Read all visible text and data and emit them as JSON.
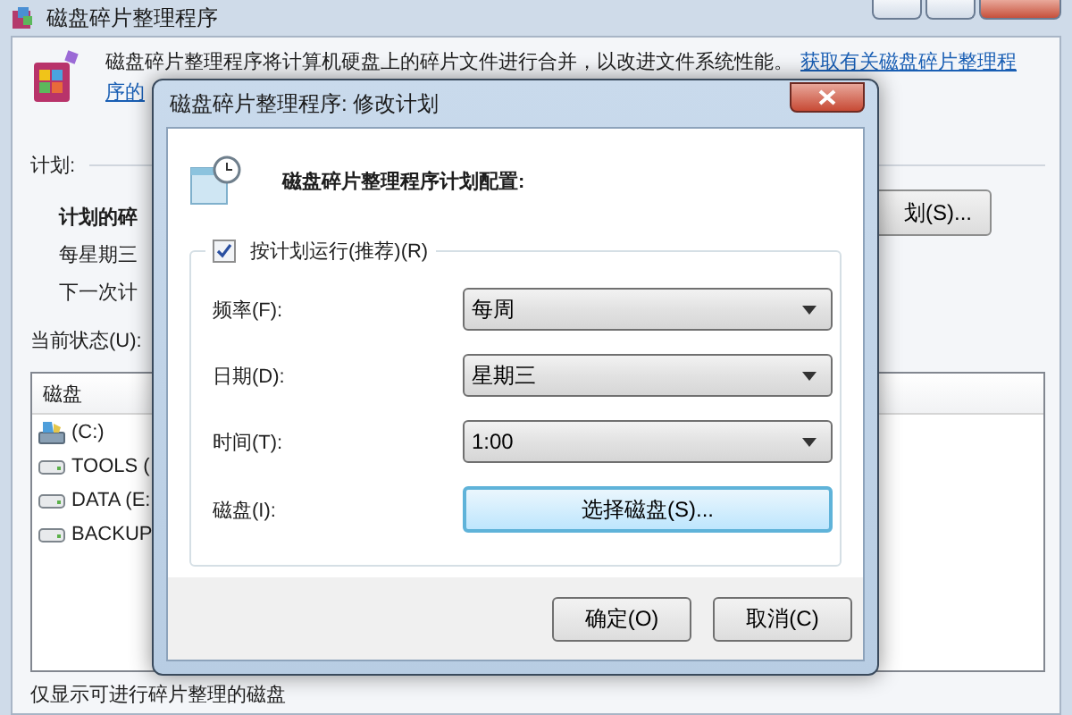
{
  "window": {
    "title": "磁盘碎片整理程序",
    "description": "磁盘碎片整理程序将计算机硬盘上的碎片文件进行合并，以改进文件系统性能。",
    "help_link_lines": [
      "获取有关磁盘碎片整理程",
      "序的"
    ]
  },
  "schedule": {
    "heading": "计划:",
    "title": "计划的碎",
    "frequency": "每星期三",
    "next_run": "下一次计",
    "configure_button": "划(S)..."
  },
  "status": {
    "label": "当前状态(U):",
    "column": "磁盘",
    "disks": [
      {
        "name": "(C:)",
        "kind": "system"
      },
      {
        "name": "TOOLS (",
        "kind": "drive"
      },
      {
        "name": "DATA (E:",
        "kind": "drive"
      },
      {
        "name": "BACKUP",
        "kind": "drive"
      }
    ]
  },
  "footer_note": "仅显示可进行碎片整理的磁盘",
  "dialog": {
    "title": "磁盘碎片整理程序: 修改计划",
    "heading": "磁盘碎片整理程序计划配置:",
    "run_on_schedule": {
      "label": "按计划运行(推荐)(R)",
      "checked": true
    },
    "fields": [
      {
        "label": "频率(F):",
        "kind": "dropdown",
        "value": "每周"
      },
      {
        "label": "日期(D):",
        "kind": "dropdown",
        "value": "星期三"
      },
      {
        "label": "时间(T):",
        "kind": "dropdown",
        "value": "1:00"
      },
      {
        "label": "磁盘(I):",
        "kind": "button",
        "value": "选择磁盘(S)..."
      }
    ],
    "buttons": [
      "确定(O)",
      "取消(C)"
    ]
  }
}
